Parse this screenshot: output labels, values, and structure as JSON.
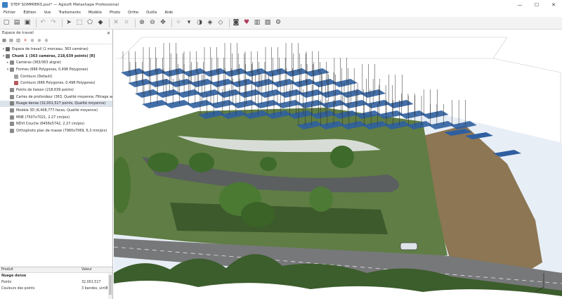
{
  "window": {
    "title": "STEP SOMMIERS.psx* — Agisoft Metashape Professional",
    "controls": [
      "—",
      "☐",
      "✕"
    ]
  },
  "menu": [
    "Fichier",
    "Édition",
    "Vue",
    "Traitements",
    "Modèle",
    "Photo",
    "Ortho",
    "Outils",
    "Aide"
  ],
  "toolbar_icons": [
    "new-icon",
    "open-icon",
    "save-icon",
    "undo-icon",
    "redo-icon",
    "navigation-icon",
    "select-icon",
    "polygon-icon",
    "measure-icon",
    "delete-icon",
    "crop-icon",
    "zoom-in-icon",
    "zoom-out-icon",
    "move-icon",
    "points-icon",
    "shading-icon",
    "camera-icon",
    "marker-icon",
    "ortho-icon"
  ],
  "workspace": {
    "header": "Espace de travail",
    "close": "✕",
    "tree": [
      {
        "label": "Espace de travail (1 morceau, 363 caméras)",
        "indent": 0,
        "bold": false,
        "color": "#666666"
      },
      {
        "label": "Chunk 1 (363 caméras, 218,639 points) [R]",
        "indent": 0,
        "bold": true,
        "color": "#7a7a7a"
      },
      {
        "label": "Caméras (363/363 aligné)",
        "indent": 1,
        "bold": false,
        "color": "#8a8a8a"
      },
      {
        "label": "Formes (666 Polygones, 0,498 Polygones)",
        "indent": 1,
        "bold": false,
        "color": "#8a8a8a"
      },
      {
        "label": "Contours (Default)",
        "indent": 2,
        "bold": false,
        "color": "#a0a0a0"
      },
      {
        "label": "Contours (666 Polygones, 0,498 Polygones)",
        "indent": 2,
        "bold": false,
        "color": "#b45a5a"
      },
      {
        "label": "Points de liaison (218,639 points)",
        "indent": 1,
        "bold": false,
        "color": "#8a8a8a"
      },
      {
        "label": "Cartes de profondeur (363, Qualité moyenne, Filtrage agressif)",
        "indent": 1,
        "bold": false,
        "color": "#8a8a8a"
      },
      {
        "label": "Nuage dense (32,001,517 points, Qualité moyenne)",
        "indent": 1,
        "bold": false,
        "color": "#7f7f7f",
        "selected": true
      },
      {
        "label": "Modèle 3D (6,408,777 faces, Qualité moyenne)",
        "indent": 1,
        "bold": false,
        "color": "#8a8a8a"
      },
      {
        "label": "MNE (7507x7021, 2.27 cm/pix)",
        "indent": 1,
        "bold": false,
        "color": "#8a8a8a"
      },
      {
        "label": "NDVI Couche (6458x5742, 2.27 cm/pix)",
        "indent": 1,
        "bold": false,
        "color": "#8a8a8a"
      },
      {
        "label": "Orthophoto plan de masse (7960x7069, 6,3 mm/pix)",
        "indent": 1,
        "bold": false,
        "color": "#8a8a8a"
      }
    ]
  },
  "properties": {
    "headers": [
      "Produit",
      "Valeur"
    ],
    "rows": [
      {
        "name": "Nuage dense",
        "value": ""
      },
      {
        "name": "Points",
        "value": "32,001,517"
      },
      {
        "name": "Couleurs des points",
        "value": "3 bandes, uint8"
      }
    ]
  },
  "scene": {
    "sky_color": "#ffffff",
    "grass_color": "#5f7d44",
    "field_color": "#8c7653",
    "pond_color": "#5b5f60",
    "road_color": "#77787a",
    "polygon_color": "#2f5fa0"
  }
}
